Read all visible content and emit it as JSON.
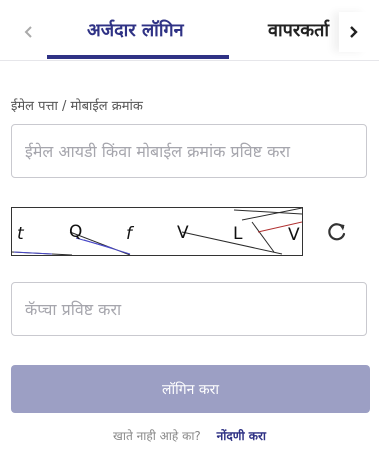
{
  "tabs": {
    "active_label": "अर्जदार लॉगिन",
    "other_label": "वापरकर्ता"
  },
  "form": {
    "email_label": "ईमेल पत्ता / मोबाईल क्रमांक",
    "email_placeholder": "ईमेल आयडी किंवा मोबाईल क्रमांक प्रविष्ट करा",
    "captcha_chars": [
      "t",
      "Q",
      "f",
      "V",
      "L",
      "V"
    ],
    "captcha_placeholder": "कॅप्चा प्रविष्ट करा",
    "login_label": "लॉगिन करा",
    "register_question": "खाते नाही आहे का?",
    "register_link": "नोंदणी करा"
  },
  "colors": {
    "accent": "#2f3285",
    "button_disabled": "#9c9fc4"
  },
  "icons": {
    "tab_prev": "chevron-left-icon",
    "tab_next": "chevron-right-icon",
    "captcha_refresh": "refresh-icon"
  }
}
